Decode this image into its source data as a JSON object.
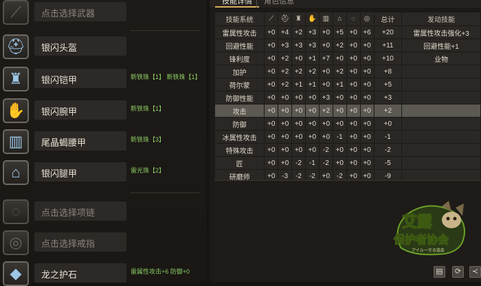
{
  "left": {
    "slots": [
      {
        "name": "点击选择武器",
        "gems": "",
        "icon": "weapon-icon",
        "empty": true
      },
      {
        "name": "银闪头盔",
        "gems": "",
        "icon": "helmet-icon",
        "empty": false
      },
      {
        "name": "银闪铠甲",
        "gems": "新铁珠【1】 新铁珠【1】",
        "icon": "chest-armor-icon",
        "empty": false
      },
      {
        "name": "银闪腕甲",
        "gems": "新铁珠【1】",
        "icon": "gauntlet-icon",
        "empty": false
      },
      {
        "name": "尾晶蝎腰甲",
        "gems": "新铁珠【3】",
        "icon": "waist-armor-icon",
        "empty": false
      },
      {
        "name": "银闪腿甲",
        "gems": "雷光珠【2】",
        "icon": "leg-armor-icon",
        "empty": false
      },
      {
        "name": "点击选择项链",
        "gems": "",
        "icon": "necklace-icon",
        "empty": true
      },
      {
        "name": "点击选择戒指",
        "gems": "",
        "icon": "ring-icon",
        "empty": true
      },
      {
        "name": "龙之护石",
        "gems": "雷属性攻击+6 防御+0",
        "icon": "charm-icon",
        "empty": false
      }
    ]
  },
  "tabs": [
    {
      "label": "技能详情",
      "active": true
    },
    {
      "label": "角色信息",
      "active": false
    }
  ],
  "table": {
    "headers": {
      "skill": "技能系统",
      "total": "总计",
      "active": "发动技能"
    },
    "header_icons": [
      "weapon-icon",
      "helmet-icon",
      "chest-armor-icon",
      "gauntlet-icon",
      "waist-armor-icon",
      "leg-armor-icon",
      "necklace-icon",
      "ring-icon"
    ],
    "rows": [
      {
        "name": "雷属性攻击",
        "values": [
          "+0",
          "+4",
          "+2",
          "+3",
          "+0",
          "+5",
          "+0",
          "+6"
        ],
        "total": "+20",
        "active": "雷属性攻击强化+3"
      },
      {
        "name": "回避性能",
        "values": [
          "+0",
          "+3",
          "+3",
          "+3",
          "+0",
          "+2",
          "+0",
          "+0"
        ],
        "total": "+11",
        "active": "回避性能+1"
      },
      {
        "name": "锋利度",
        "values": [
          "+0",
          "+2",
          "+0",
          "+1",
          "+7",
          "+0",
          "+0",
          "+0"
        ],
        "total": "+10",
        "active": "业物"
      },
      {
        "name": "加护",
        "values": [
          "+0",
          "+2",
          "+2",
          "+2",
          "+0",
          "+2",
          "+0",
          "+0"
        ],
        "total": "+8",
        "active": ""
      },
      {
        "name": "荷尔蒙",
        "values": [
          "+0",
          "+2",
          "+1",
          "+1",
          "+0",
          "+1",
          "+0",
          "+0"
        ],
        "total": "+5",
        "active": ""
      },
      {
        "name": "防御性能",
        "values": [
          "+0",
          "+0",
          "+0",
          "+0",
          "+3",
          "+0",
          "+0",
          "+0"
        ],
        "total": "+3",
        "active": ""
      },
      {
        "name": "攻击",
        "values": [
          "+0",
          "+0",
          "+0",
          "+0",
          "+2",
          "+0",
          "+0",
          "+0"
        ],
        "total": "+2",
        "active": "",
        "selected": true
      },
      {
        "name": "防御",
        "values": [
          "+0",
          "+0",
          "+0",
          "+0",
          "+0",
          "+0",
          "+0",
          "+0"
        ],
        "total": "+0",
        "active": ""
      },
      {
        "name": "冰属性攻击",
        "values": [
          "+0",
          "+0",
          "+0",
          "+0",
          "+0",
          "-1",
          "+0",
          "+0"
        ],
        "total": "-1",
        "active": ""
      },
      {
        "name": "特殊攻击",
        "values": [
          "+0",
          "+0",
          "+0",
          "+0",
          "-2",
          "+0",
          "+0",
          "+0"
        ],
        "total": "-2",
        "active": ""
      },
      {
        "name": "匠",
        "values": [
          "+0",
          "+0",
          "-2",
          "-1",
          "-2",
          "+0",
          "+0",
          "+0"
        ],
        "total": "-5",
        "active": ""
      },
      {
        "name": "研磨师",
        "values": [
          "+0",
          "-3",
          "-2",
          "-2",
          "+0",
          "-2",
          "+0",
          "+0"
        ],
        "total": "-9",
        "active": ""
      }
    ]
  },
  "logo": {
    "line1": "艾露",
    "line2": "保护者协会",
    "sub": "アイルー守る協会"
  },
  "colors": {
    "gem_text": "#8acb62",
    "selected_row": "#5c5852",
    "accent": "#d8b060"
  }
}
